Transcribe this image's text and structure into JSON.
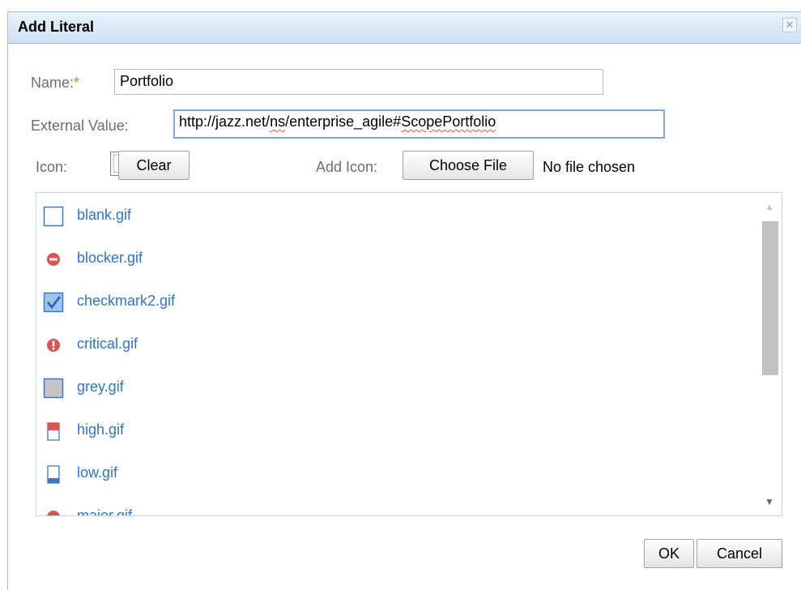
{
  "dialog": {
    "title": "Add Literal",
    "close_icon": "close-icon"
  },
  "form": {
    "name_label": "Name:",
    "name_required_marker": "*",
    "name_value": "Portfolio",
    "external_value_label": "External Value:",
    "external_value_prefix": "http://jazz.net/",
    "external_value_ns": "ns",
    "external_value_mid": "/enterprise_agile#",
    "external_value_suffix": "ScopePortfolio",
    "icon_label": "Icon:",
    "clear_label": "Clear",
    "add_icon_label": "Add Icon:",
    "choose_file_label": "Choose File",
    "no_file_text": "No file chosen"
  },
  "icon_list": [
    {
      "label": "blank.gif",
      "icon": "blank-square-icon"
    },
    {
      "label": "blocker.gif",
      "icon": "blocker-icon"
    },
    {
      "label": "checkmark2.gif",
      "icon": "checkmark-icon"
    },
    {
      "label": "critical.gif",
      "icon": "critical-icon"
    },
    {
      "label": "grey.gif",
      "icon": "grey-square-icon"
    },
    {
      "label": "high.gif",
      "icon": "high-priority-icon"
    },
    {
      "label": "low.gif",
      "icon": "low-priority-icon"
    },
    {
      "label": "major.gif",
      "icon": "major-icon"
    }
  ],
  "colors": {
    "link": "#2e77c6",
    "required": "#e07a26",
    "titlebar": "#cde0f3"
  },
  "actions": {
    "ok_label": "OK",
    "cancel_label": "Cancel"
  }
}
